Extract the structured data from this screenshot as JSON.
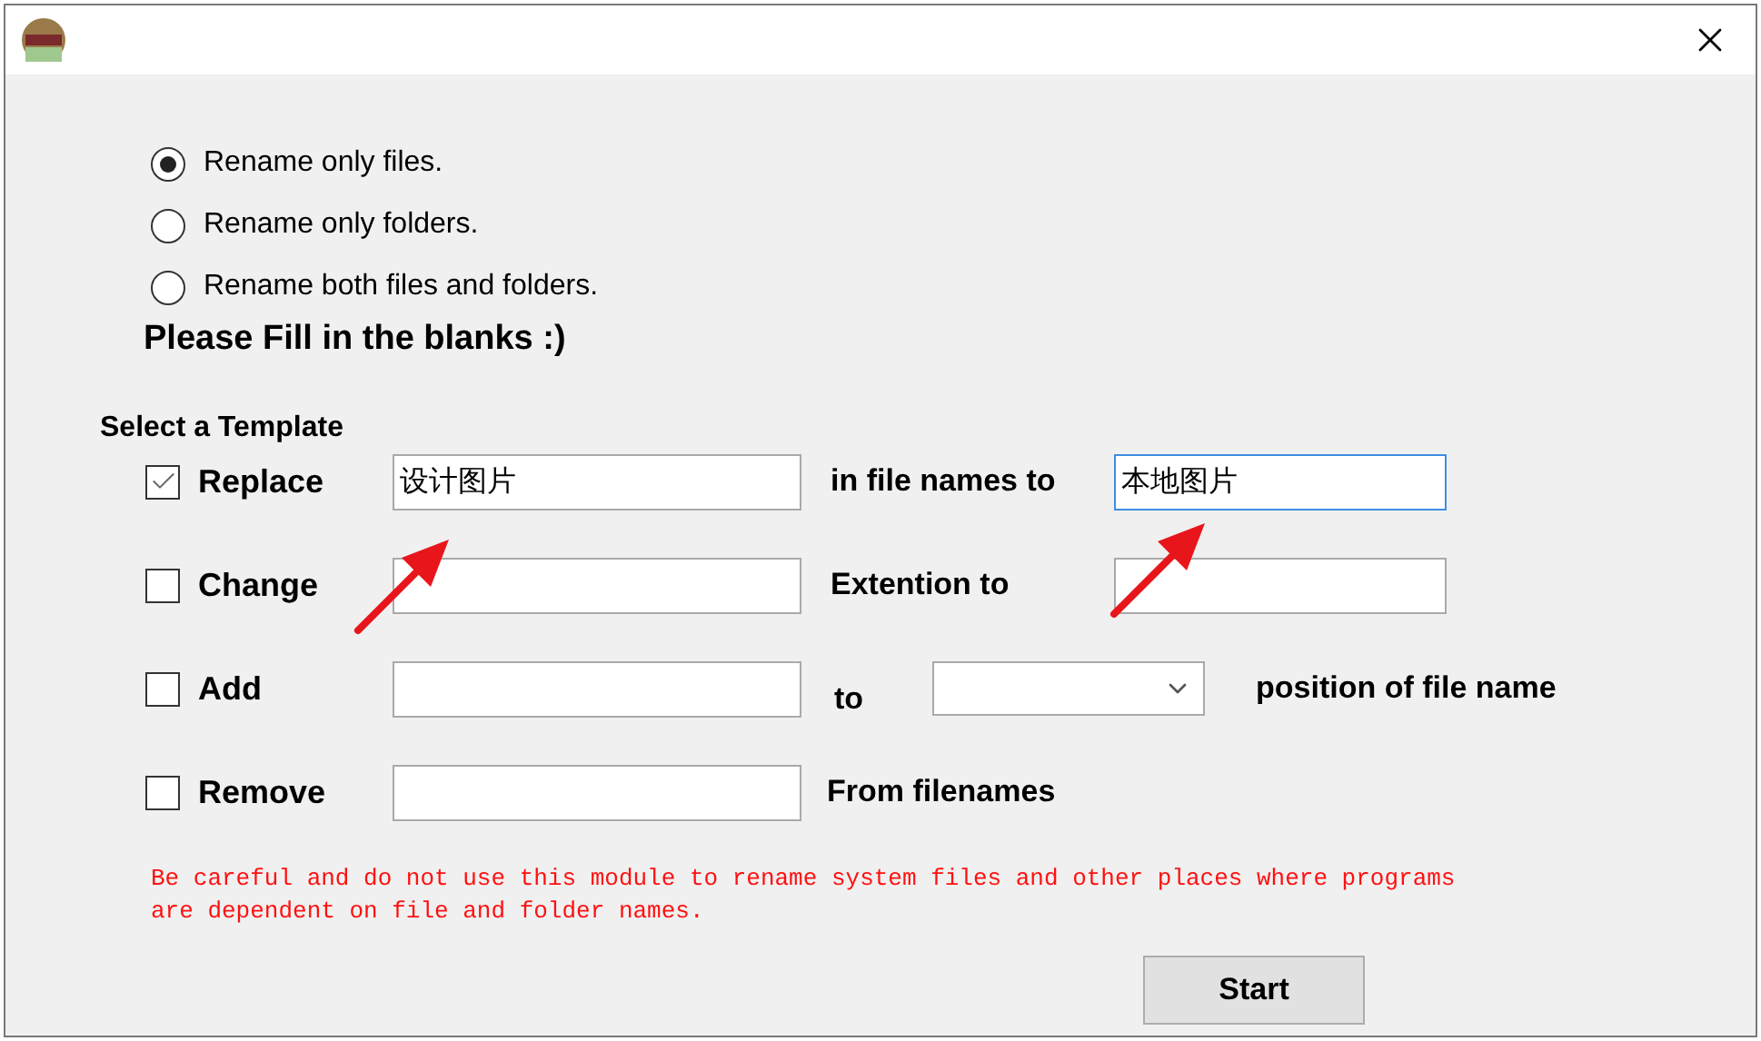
{
  "options": [
    {
      "label": "Rename only files.",
      "selected": true
    },
    {
      "label": "Rename only folders.",
      "selected": false
    },
    {
      "label": "Rename both files and folders.",
      "selected": false
    }
  ],
  "heading": "Please Fill in the blanks :)",
  "template_label": "Select a Template",
  "templates": [
    {
      "kind": "text_target",
      "label": "Replace",
      "checked": true,
      "value": "设计图片",
      "connector": "in file names to",
      "target_value": "本地图片",
      "target_focused": true
    },
    {
      "kind": "text_target",
      "label": "Change",
      "checked": false,
      "connector": "Extention to",
      "target_focused": false
    },
    {
      "kind": "position",
      "label": "Add",
      "checked": false,
      "connector": "to",
      "suffix": "position of file name"
    },
    {
      "kind": "simple",
      "label": "Remove",
      "checked": false,
      "connector": "From filenames"
    }
  ],
  "warning": "Be careful and do not use this module to rename system files and other places where programs are dependent on file and folder names.",
  "start_button": "Start"
}
